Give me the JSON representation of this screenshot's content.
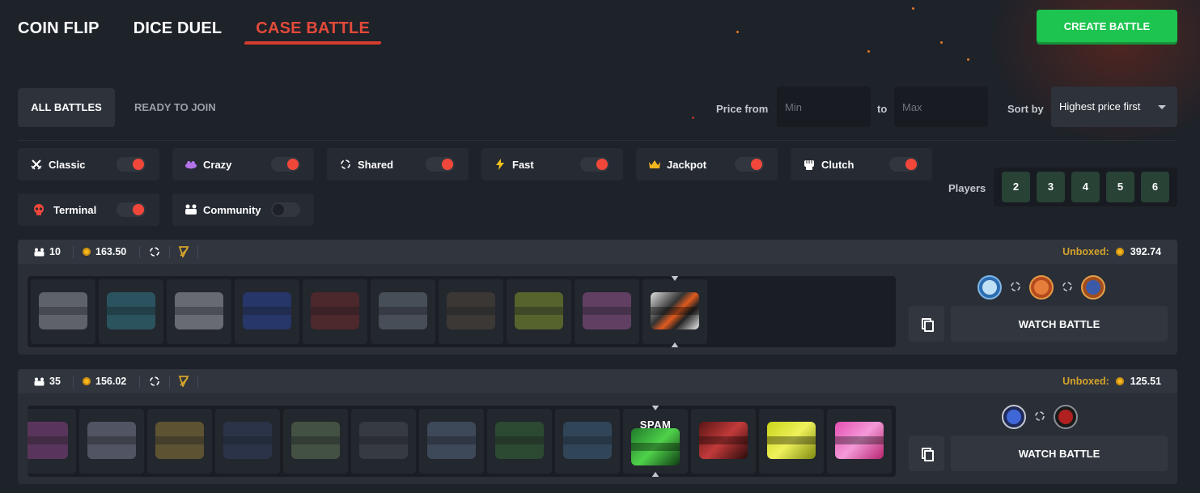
{
  "nav": {
    "tabs": [
      {
        "label": "COIN FLIP"
      },
      {
        "label": "DICE DUEL"
      },
      {
        "label": "CASE BATTLE"
      }
    ],
    "active_tab": "CASE BATTLE",
    "create_label": "CREATE BATTLE"
  },
  "filters": {
    "all_battles": "ALL BATTLES",
    "ready_to_join": "READY TO JOIN",
    "price_from": "Price from",
    "to": "to",
    "min_placeholder": "Min",
    "max_placeholder": "Max",
    "sort_by": "Sort by",
    "sort_value": "Highest price first"
  },
  "modes": [
    {
      "label": "Classic",
      "icon": "swords-icon",
      "on": true
    },
    {
      "label": "Crazy",
      "icon": "crazy-icon",
      "on": true
    },
    {
      "label": "Shared",
      "icon": "shared-icon",
      "on": true
    },
    {
      "label": "Fast",
      "icon": "lightning-icon",
      "on": true
    },
    {
      "label": "Jackpot",
      "icon": "crown-icon",
      "on": true
    },
    {
      "label": "Clutch",
      "icon": "fist-icon",
      "on": true
    },
    {
      "label": "Terminal",
      "icon": "skull-icon",
      "on": true
    },
    {
      "label": "Community",
      "icon": "community-icon",
      "on": false
    }
  ],
  "players": {
    "label": "Players",
    "options": [
      "2",
      "3",
      "4",
      "5",
      "6"
    ]
  },
  "battles": [
    {
      "rounds": "10",
      "price": "163.50",
      "unboxed_label": "Unboxed:",
      "unboxed_value": "392.74",
      "watch_label": "WATCH BATTLE"
    },
    {
      "rounds": "35",
      "price": "156.02",
      "unboxed_label": "Unboxed:",
      "unboxed_value": "125.51",
      "watch_label": "WATCH BATTLE",
      "current_case_label": "SPAM"
    }
  ],
  "colors": {
    "accent_red": "#e34a3a",
    "create_green": "#1dc44f",
    "toggle_on": "#f0473a",
    "gold": "#d5a32a",
    "player_btn": "#284236"
  }
}
